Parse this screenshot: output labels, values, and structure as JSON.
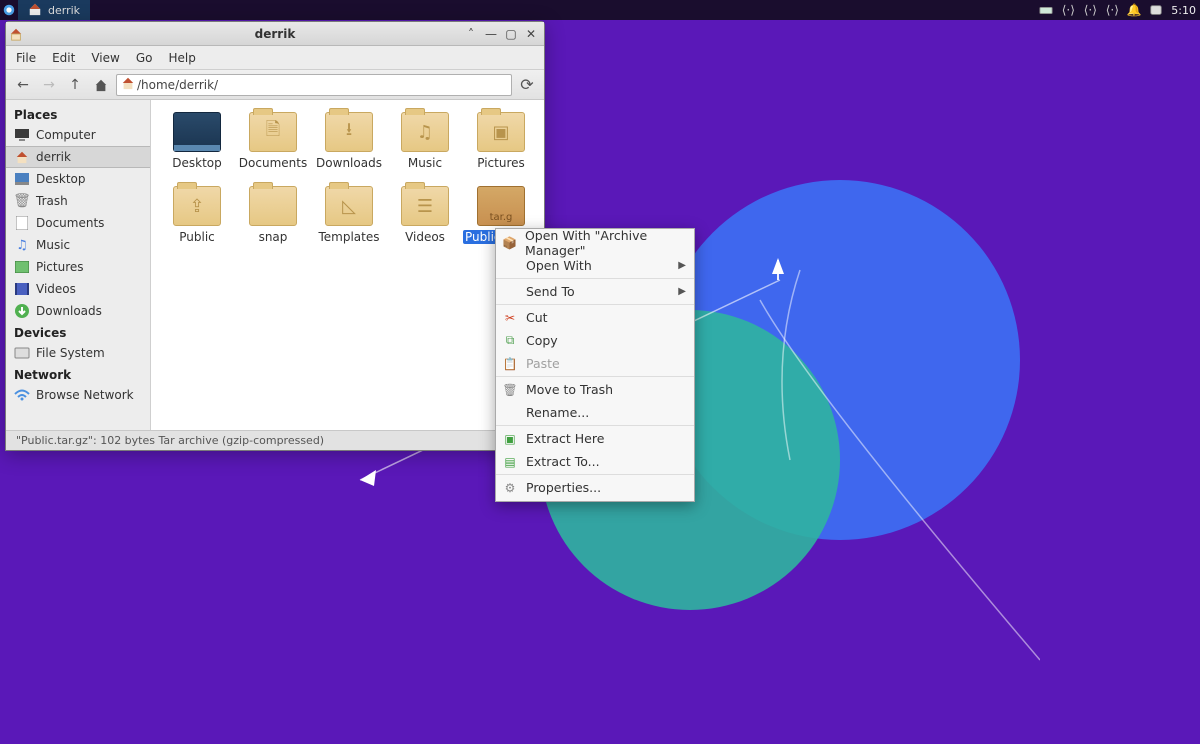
{
  "panel": {
    "task_label": "derrik",
    "clock": "5:10"
  },
  "fm": {
    "title": "derrik",
    "menu": {
      "file": "File",
      "edit": "Edit",
      "view": "View",
      "go": "Go",
      "help": "Help"
    },
    "path": "/home/derrik/",
    "sidebar": {
      "places_heading": "Places",
      "places": [
        {
          "icon": "computer",
          "label": "Computer"
        },
        {
          "icon": "home",
          "label": "derrik"
        },
        {
          "icon": "desktop",
          "label": "Desktop"
        },
        {
          "icon": "trash",
          "label": "Trash"
        },
        {
          "icon": "doc",
          "label": "Documents"
        },
        {
          "icon": "music",
          "label": "Music"
        },
        {
          "icon": "pictures",
          "label": "Pictures"
        },
        {
          "icon": "videos",
          "label": "Videos"
        },
        {
          "icon": "download",
          "label": "Downloads"
        }
      ],
      "devices_heading": "Devices",
      "devices": [
        {
          "icon": "disk",
          "label": "File System"
        }
      ],
      "network_heading": "Network",
      "network": [
        {
          "icon": "wifi",
          "label": "Browse Network"
        }
      ]
    },
    "files": [
      {
        "type": "desktop",
        "glyph": "",
        "label": "Desktop"
      },
      {
        "type": "folder",
        "glyph": "🗎",
        "label": "Documents"
      },
      {
        "type": "folder",
        "glyph": "⭳",
        "label": "Downloads"
      },
      {
        "type": "folder",
        "glyph": "♫",
        "label": "Music"
      },
      {
        "type": "folder",
        "glyph": "▣",
        "label": "Pictures"
      },
      {
        "type": "folder",
        "glyph": "⇪",
        "label": "Public"
      },
      {
        "type": "folder",
        "glyph": "",
        "label": "snap"
      },
      {
        "type": "folder",
        "glyph": "◺",
        "label": "Templates"
      },
      {
        "type": "folder",
        "glyph": "☰",
        "label": "Videos"
      },
      {
        "type": "archive",
        "glyph": "tar.g",
        "label": "Public.tar.gz",
        "selected": true
      }
    ],
    "status": "\"Public.tar.gz\": 102 bytes Tar archive (gzip-compressed)"
  },
  "ctx": {
    "open_with_app": "Open With \"Archive Manager\"",
    "open_with": "Open With",
    "send_to": "Send To",
    "cut": "Cut",
    "copy": "Copy",
    "paste": "Paste",
    "move_trash": "Move to Trash",
    "rename": "Rename...",
    "extract_here": "Extract Here",
    "extract_to": "Extract To...",
    "properties": "Properties..."
  }
}
